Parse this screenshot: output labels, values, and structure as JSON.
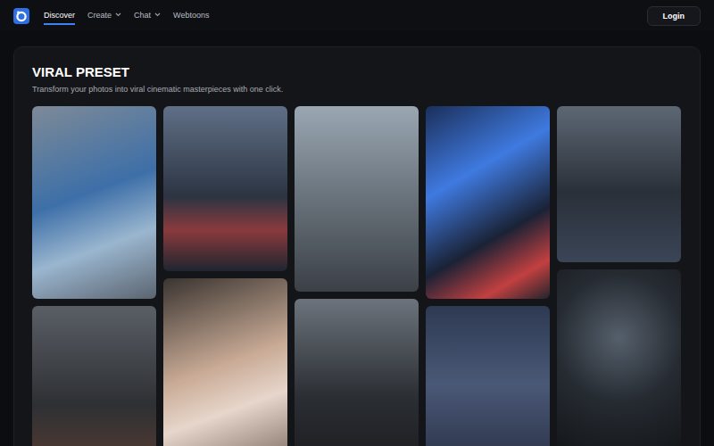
{
  "nav": {
    "tabs": [
      {
        "label": "Discover",
        "selected": true,
        "kind": "link"
      },
      {
        "label": "Create",
        "selected": false,
        "kind": "menu"
      },
      {
        "label": "Chat",
        "selected": false,
        "kind": "menu"
      },
      {
        "label": "Webtoons",
        "selected": false,
        "kind": "link"
      }
    ],
    "login": "Login"
  },
  "section": {
    "title": "VIRAL PRESET",
    "subtitle": "Transform your photos into viral cinematic masterpieces with one click."
  }
}
